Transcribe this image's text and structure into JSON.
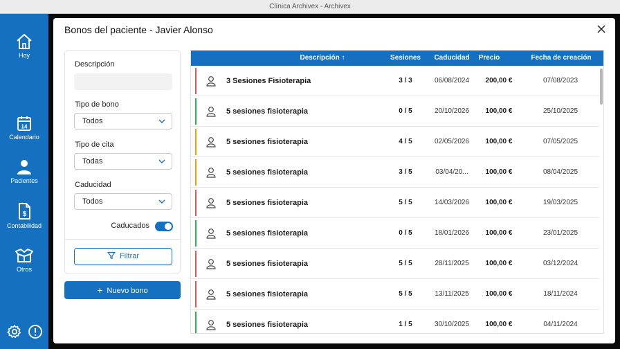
{
  "window": {
    "title": "Clínica Archivex - Archivex"
  },
  "sidebar": {
    "items": [
      {
        "label": "Hoy",
        "icon": "home-icon"
      },
      {
        "label": "Calendario",
        "icon": "calendar-icon",
        "day": "14"
      },
      {
        "label": "Pacientes",
        "icon": "person-icon"
      },
      {
        "label": "Contabilidad",
        "icon": "invoice-icon"
      },
      {
        "label": "Otros",
        "icon": "box-icon"
      }
    ],
    "bottom": [
      "gear-icon",
      "alert-icon"
    ]
  },
  "modal": {
    "title": "Bonos del paciente - Javier Alonso"
  },
  "filters": {
    "description_label": "Descripción",
    "description_value": "",
    "tipo_bono_label": "Tipo de bono",
    "tipo_bono_value": "Todos",
    "tipo_cita_label": "Tipo de cita",
    "tipo_cita_value": "Todas",
    "caducidad_label": "Caducidad",
    "caducidad_value": "Todos",
    "caducados_label": "Caducados",
    "caducados_on": true,
    "filter_button": "Filtrar",
    "new_button": "Nuevo bono"
  },
  "table": {
    "columns": [
      "Descripción ↑",
      "Sesiones",
      "Caducidad",
      "Precio",
      "Fecha de creación"
    ],
    "colors": {
      "red": "#e05555",
      "green": "#2db34a",
      "orange": "#f0a400"
    },
    "rows": [
      {
        "status": "red",
        "desc": "3 Sesiones Fisioterapia",
        "ses": "3 / 3",
        "cad": "06/08/2024",
        "pre": "200,00 €",
        "fec": "07/08/2023"
      },
      {
        "status": "green",
        "desc": "5 sesiones fisioterapia",
        "ses": "0 / 5",
        "cad": "20/10/2026",
        "pre": "100,00 €",
        "fec": "25/10/2025"
      },
      {
        "status": "orange",
        "desc": "5 sesiones fisioterapia",
        "ses": "4 / 5",
        "cad": "02/05/2026",
        "pre": "100,00 €",
        "fec": "07/05/2025"
      },
      {
        "status": "orange",
        "desc": "5 sesiones fisioterapia",
        "ses": "3 / 5",
        "cad": "03/04/20...",
        "pre": "100,00 €",
        "fec": "08/04/2025"
      },
      {
        "status": "red",
        "desc": "5 sesiones fisioterapia",
        "ses": "5 / 5",
        "cad": "14/03/2026",
        "pre": "100,00 €",
        "fec": "19/03/2025"
      },
      {
        "status": "green",
        "desc": "5 sesiones fisioterapia",
        "ses": "0 / 5",
        "cad": "18/01/2026",
        "pre": "100,00 €",
        "fec": "23/01/2025"
      },
      {
        "status": "red",
        "desc": "5 sesiones fisioterapia",
        "ses": "5 / 5",
        "cad": "28/11/2025",
        "pre": "100,00 €",
        "fec": "03/12/2024"
      },
      {
        "status": "red",
        "desc": "5 sesiones fisioterapia",
        "ses": "5 / 5",
        "cad": "13/11/2025",
        "pre": "100,00 €",
        "fec": "18/11/2024"
      },
      {
        "status": "green",
        "desc": "5 sesiones fisioterapia",
        "ses": "1 / 5",
        "cad": "30/10/2025",
        "pre": "100,00 €",
        "fec": "04/11/2024"
      }
    ]
  }
}
